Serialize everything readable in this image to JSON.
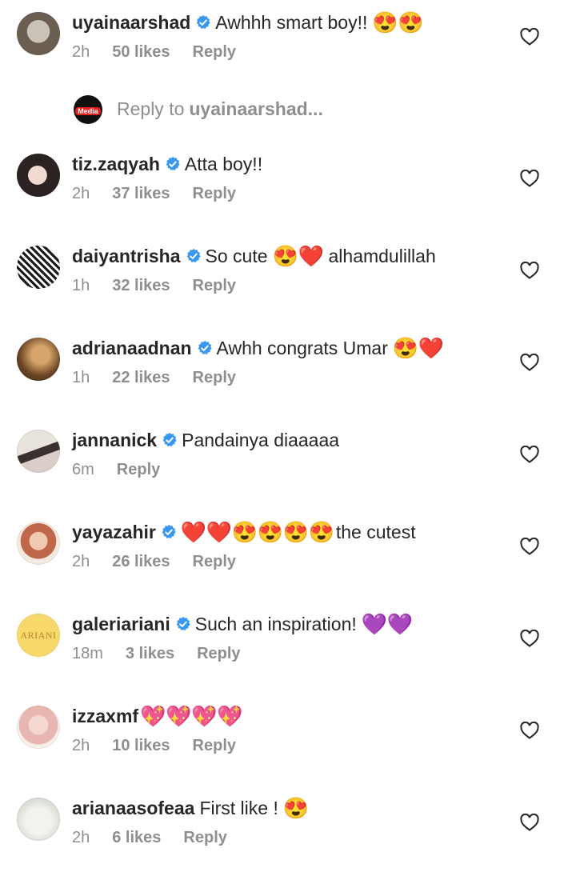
{
  "colors": {
    "verified_blue": "#3897f0",
    "meta_gray": "#8e8e8e",
    "text": "#262626",
    "heart_outline": "#262626"
  },
  "comments": [
    {
      "username": "uyainaarshad",
      "verified": true,
      "text": "Awhhh smart boy!!",
      "emoji": [
        "😍",
        "😍"
      ],
      "time": "2h",
      "likes": "50 likes",
      "reply": "Reply"
    },
    {
      "username": "tiz.zaqyah",
      "verified": true,
      "text": "Atta boy!!",
      "emoji": [],
      "time": "2h",
      "likes": "37 likes",
      "reply": "Reply"
    },
    {
      "username": "daiyantrisha",
      "verified": true,
      "text": "So cute",
      "emoji": [
        "😍",
        "❤️"
      ],
      "text_after": "alhamdulillah",
      "time": "1h",
      "likes": "32 likes",
      "reply": "Reply"
    },
    {
      "username": "adrianaadnan",
      "verified": true,
      "text": "Awhh congrats Umar",
      "emoji": [
        "😍",
        "❤️"
      ],
      "time": "1h",
      "likes": "22 likes",
      "reply": "Reply"
    },
    {
      "username": "jannanick",
      "verified": true,
      "text": "Pandainya diaaaaa",
      "emoji": [],
      "time": "6m",
      "likes": "",
      "reply": "Reply"
    },
    {
      "username": "yayazahir",
      "verified": true,
      "text": "",
      "emoji": [
        "❤️",
        "❤️",
        "😍",
        "😍",
        "😍",
        "😍"
      ],
      "text_after": "the cutest",
      "time": "2h",
      "likes": "26 likes",
      "reply": "Reply"
    },
    {
      "username": "galeriariani",
      "verified": true,
      "text": "Such an inspiration!",
      "emoji": [
        "💜",
        "💜"
      ],
      "time": "18m",
      "likes": "3 likes",
      "reply": "Reply",
      "avatar_text": "ARIANI"
    },
    {
      "username": "izzaxmf",
      "verified": false,
      "text": "",
      "emoji": [
        "💖",
        "💖",
        "💖",
        "💖"
      ],
      "time": "2h",
      "likes": "10 likes",
      "reply": "Reply"
    },
    {
      "username": "arianaasofeaa",
      "verified": false,
      "text": "First like !",
      "emoji": [
        "😍"
      ],
      "time": "2h",
      "likes": "6 likes",
      "reply": "Reply"
    }
  ],
  "reply_prompt": {
    "prefix": "Reply to",
    "username": "uyainaarshad...",
    "avatar_text": "Media"
  }
}
